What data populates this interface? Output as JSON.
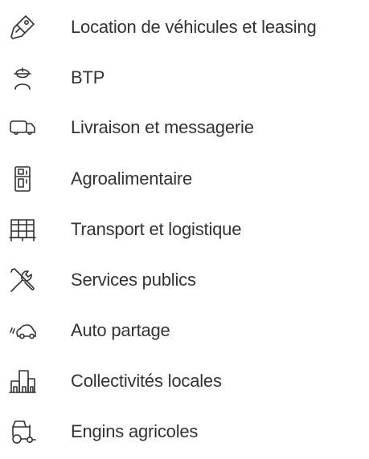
{
  "sectors": {
    "items": [
      {
        "label": "Location de véhicules et leasing",
        "icon": "car-key-icon"
      },
      {
        "label": "BTP",
        "icon": "construction-worker-icon"
      },
      {
        "label": "Livraison et messagerie",
        "icon": "delivery-truck-icon"
      },
      {
        "label": "Agroalimentaire",
        "icon": "refrigerator-icon"
      },
      {
        "label": "Transport et logistique",
        "icon": "pallet-boxes-icon"
      },
      {
        "label": "Services publics",
        "icon": "tools-icon"
      },
      {
        "label": "Auto partage",
        "icon": "car-signal-icon"
      },
      {
        "label": "Collectivités locales",
        "icon": "city-buildings-icon"
      },
      {
        "label": "Engins agricoles",
        "icon": "tractor-icon"
      }
    ]
  },
  "colors": {
    "text": "#333333",
    "icon": "#333333",
    "background": "#ffffff"
  }
}
